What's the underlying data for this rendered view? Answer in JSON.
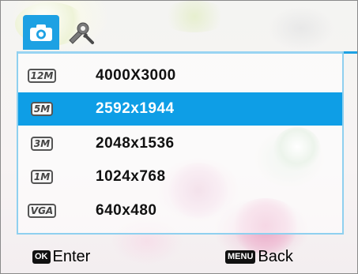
{
  "tabs": [
    {
      "icon": "camera-icon",
      "active": true
    },
    {
      "icon": "settings-icon",
      "active": false
    }
  ],
  "resolutions": [
    {
      "icon_text": "12M",
      "label": "4000X3000",
      "selected": false
    },
    {
      "icon_text": "5M",
      "label": "2592x1944",
      "selected": true
    },
    {
      "icon_text": "3M",
      "label": "2048x1536",
      "selected": false
    },
    {
      "icon_text": "1M",
      "label": "1024x768",
      "selected": false
    },
    {
      "icon_text": "VGA",
      "label": "640x480",
      "selected": false
    }
  ],
  "footer": {
    "enter_key": "OK",
    "enter_label": "Enter",
    "back_key": "MENU",
    "back_label": "Back"
  },
  "colors": {
    "accent": "#1da1e3",
    "selection": "#0e9ee6"
  }
}
